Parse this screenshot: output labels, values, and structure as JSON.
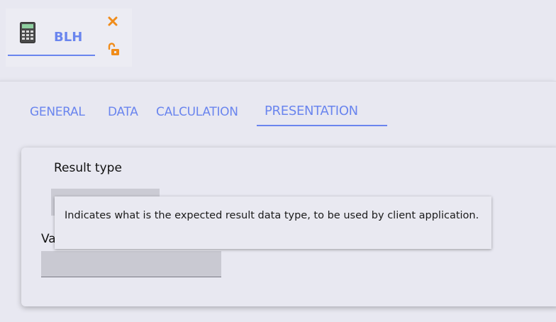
{
  "document_tab": {
    "title": "BLH",
    "icon": "calculator-icon",
    "actions": [
      {
        "name": "close",
        "icon": "close-icon",
        "color": "#f08c1a"
      },
      {
        "name": "unlock",
        "icon": "unlock-icon",
        "color": "#f08c1a"
      }
    ]
  },
  "section_tabs": [
    {
      "label": "GENERAL",
      "active": false
    },
    {
      "label": "DATA",
      "active": false
    },
    {
      "label": "CALCULATION",
      "active": false
    },
    {
      "label": "PRESENTATION",
      "active": true
    }
  ],
  "form": {
    "result_type_label": "Result type",
    "result_type_value": "",
    "value_label": "Va",
    "value_input": ""
  },
  "tooltip": {
    "text": "Indicates what is the expected result data type, to be used by client application."
  },
  "colors": {
    "accent": "#6a85ee",
    "action": "#f08c1a",
    "background": "#e8e8f1"
  }
}
